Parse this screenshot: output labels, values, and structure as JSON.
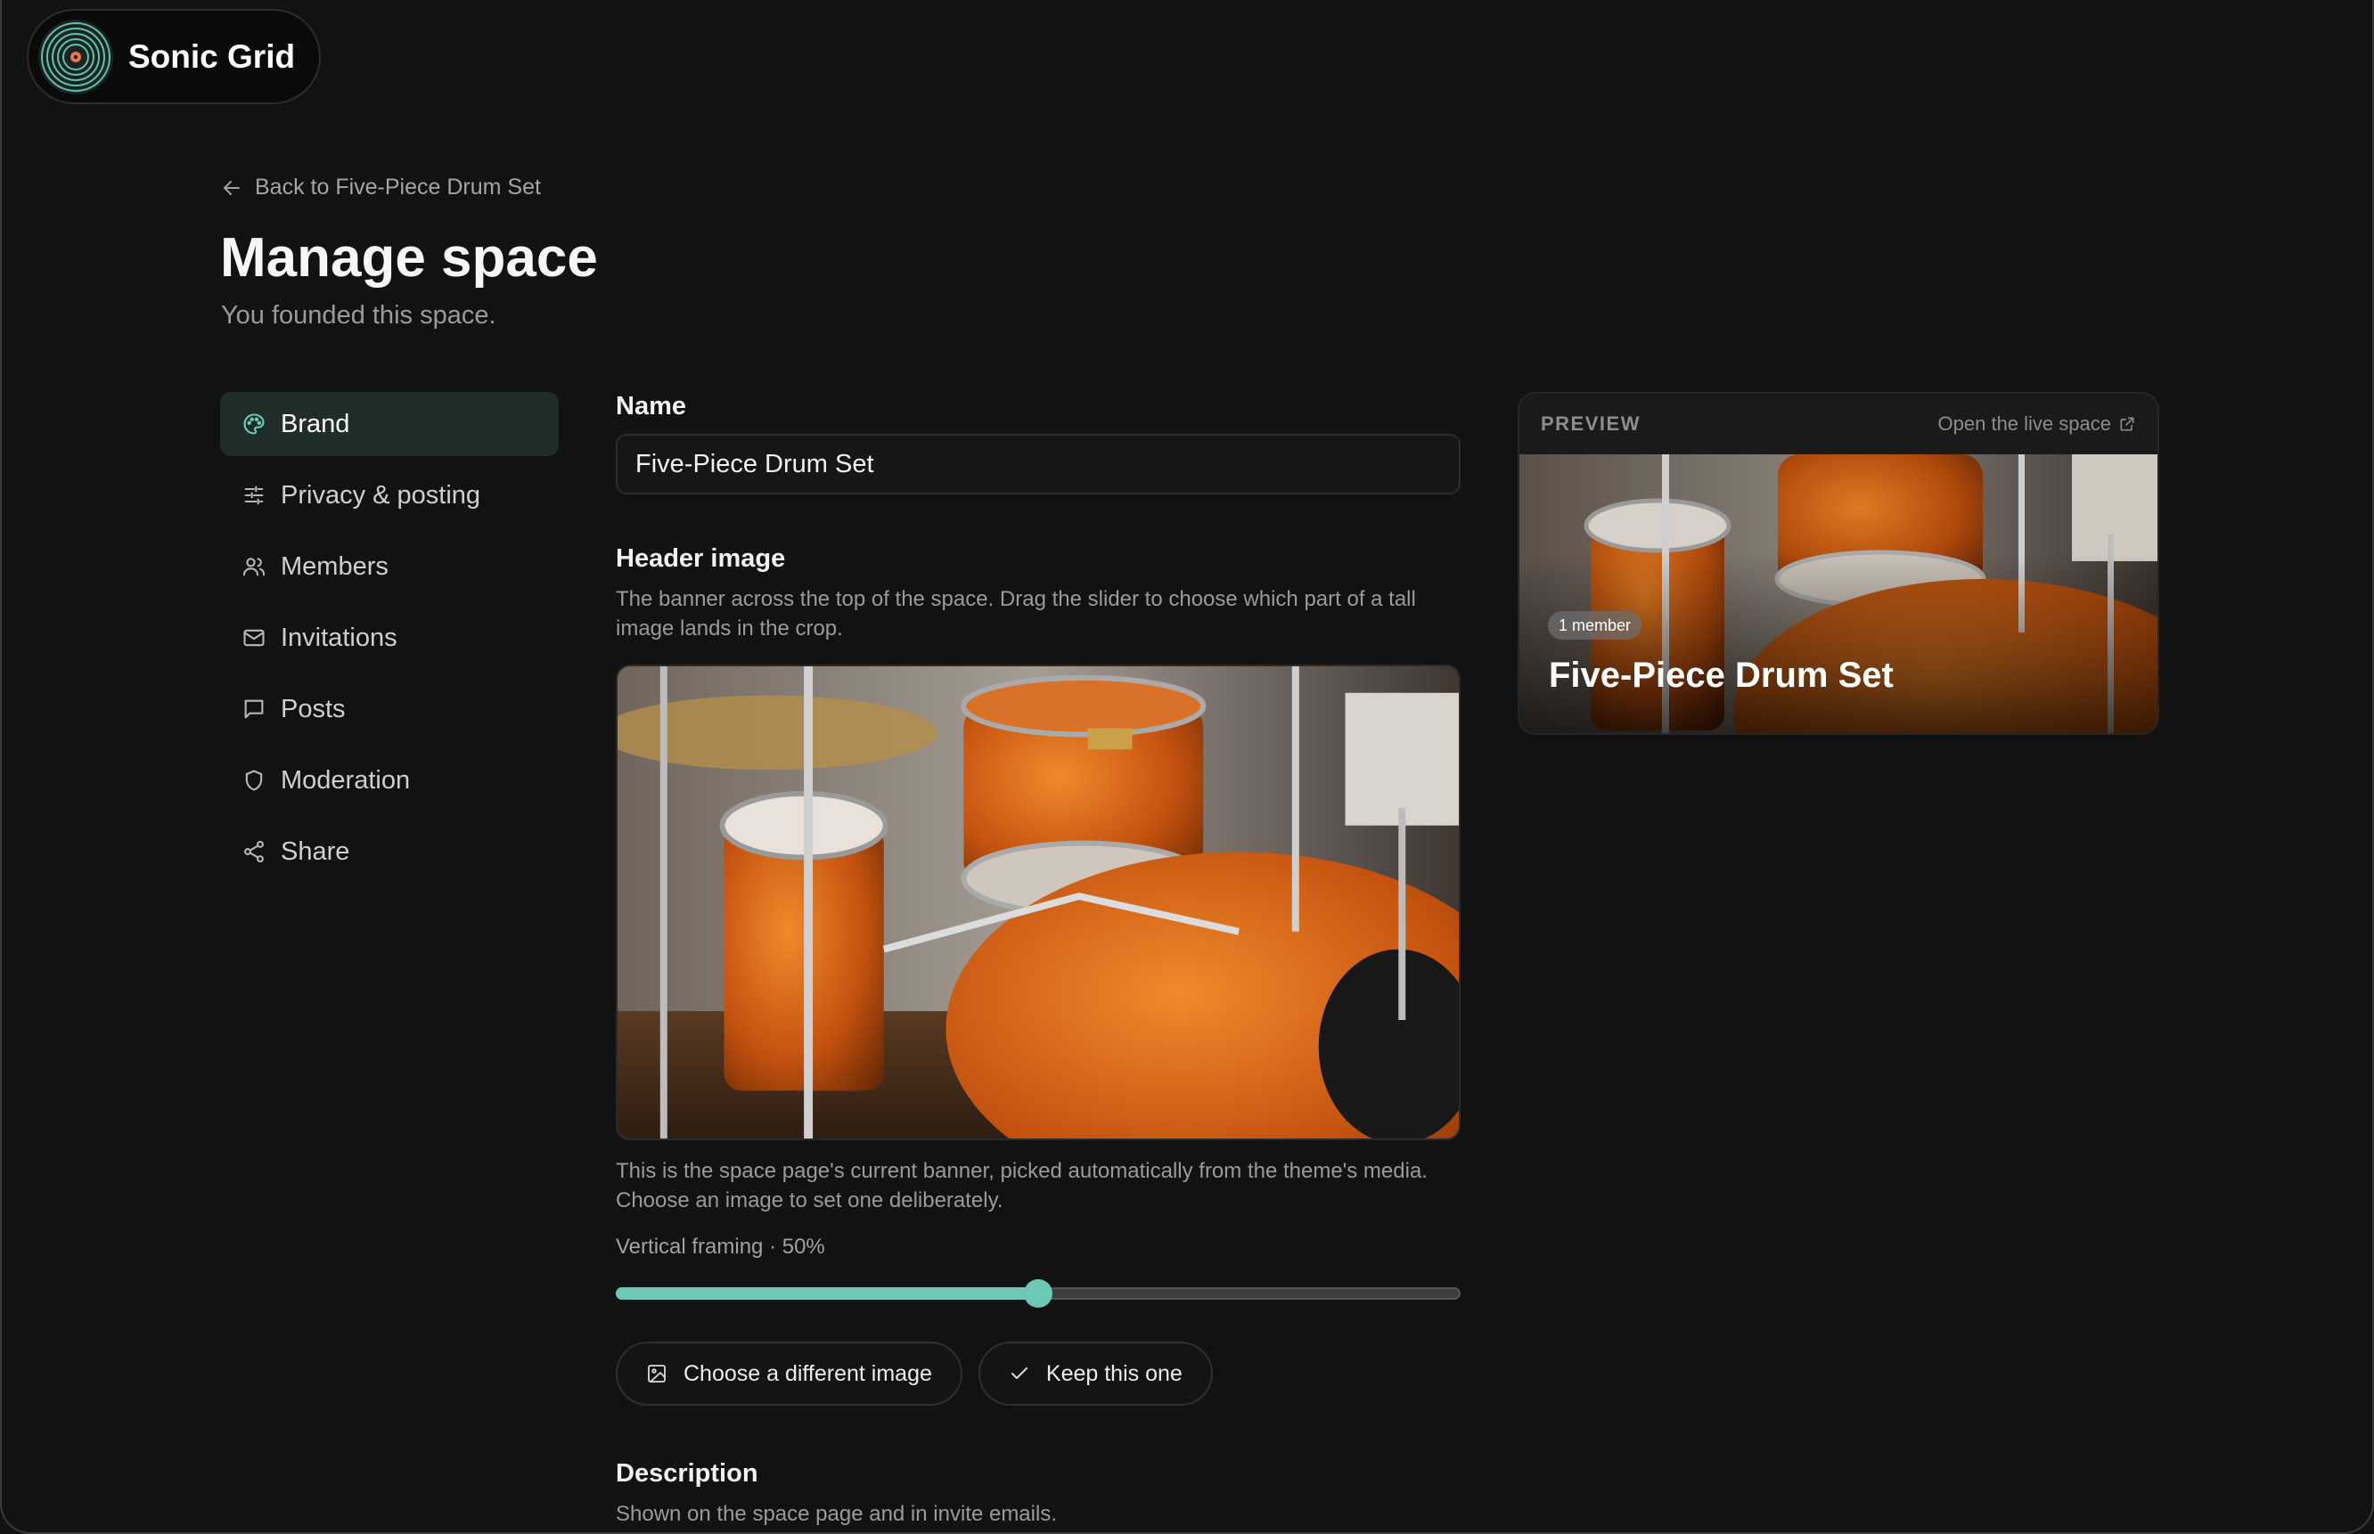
{
  "app": {
    "name": "Sonic Grid"
  },
  "header": {
    "back_label": "Back to Five-Piece Drum Set",
    "title": "Manage space",
    "subtitle": "You founded this space."
  },
  "sidebar": {
    "items": [
      {
        "label": "Brand",
        "icon": "palette-icon",
        "active": true
      },
      {
        "label": "Privacy & posting",
        "icon": "sliders-icon",
        "active": false
      },
      {
        "label": "Members",
        "icon": "users-icon",
        "active": false
      },
      {
        "label": "Invitations",
        "icon": "mail-icon",
        "active": false
      },
      {
        "label": "Posts",
        "icon": "message-icon",
        "active": false
      },
      {
        "label": "Moderation",
        "icon": "shield-icon",
        "active": false
      },
      {
        "label": "Share",
        "icon": "share-icon",
        "active": false
      }
    ]
  },
  "form": {
    "name_label": "Name",
    "name_value": "Five-Piece Drum Set",
    "header_label": "Header image",
    "header_help": "The banner across the top of the space. Drag the slider to choose which part of a tall image lands in the crop.",
    "banner_note": "This is the space page's current banner, picked automatically from the theme's media. Choose an image to set one deliberately.",
    "framing_label": "Vertical framing · 50%",
    "framing_value": 50,
    "choose_button": "Choose a different image",
    "keep_button": "Keep this one",
    "description_label": "Description",
    "description_help": "Shown on the space page and in invite emails."
  },
  "preview": {
    "tag": "PREVIEW",
    "link": "Open the live space",
    "badge": "1 member",
    "title": "Five-Piece Drum Set"
  },
  "colors": {
    "background": "#121212",
    "accent": "#6cc9b5",
    "active_nav": "#1f2e2b"
  }
}
